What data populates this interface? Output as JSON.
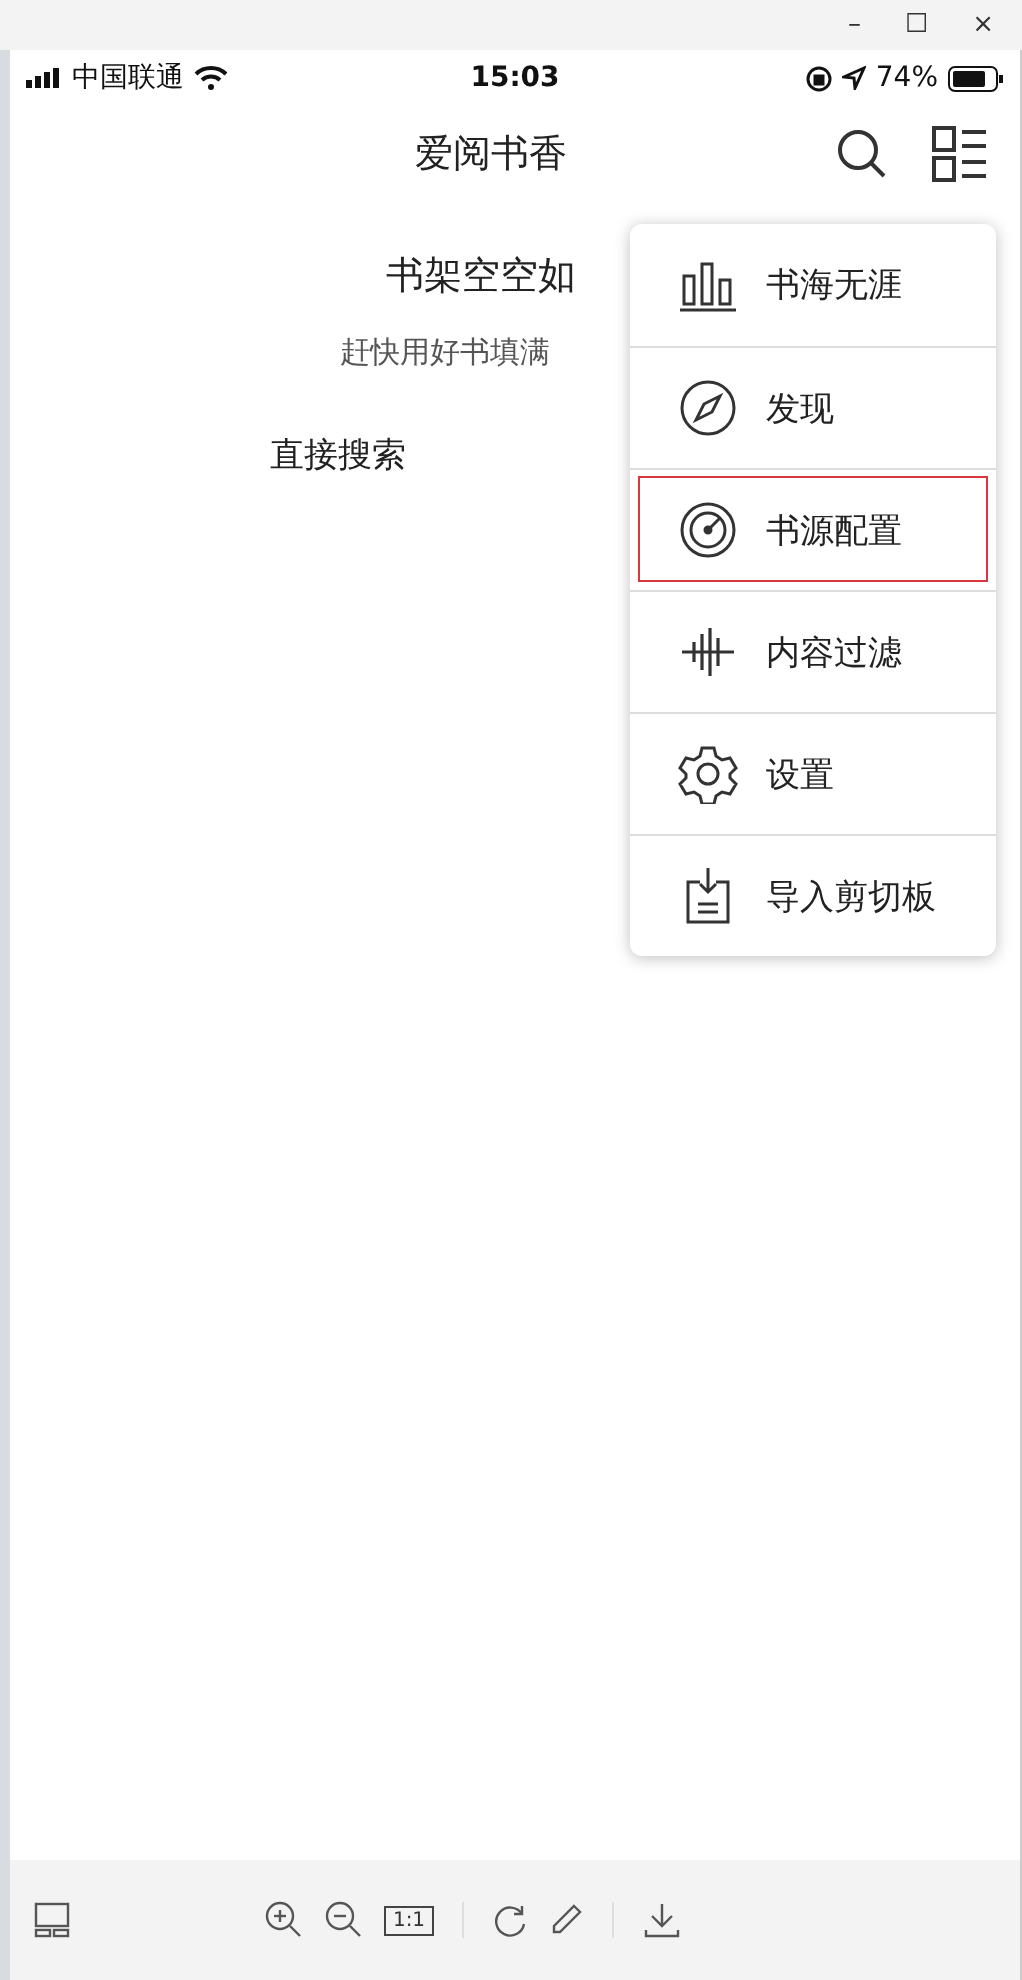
{
  "window": {
    "controls": [
      "–",
      "☐",
      "×"
    ]
  },
  "status_bar": {
    "carrier": "中国联通",
    "time": "15:03",
    "battery": "74%"
  },
  "nav": {
    "title": "爱阅书香"
  },
  "empty_state": {
    "title": "书架空空如",
    "subtitle": "赶快用好书填满",
    "actions": [
      "直接搜索"
    ]
  },
  "menu": [
    {
      "kind": "bars",
      "label": "书海无涯",
      "highlighted": false
    },
    {
      "kind": "compass",
      "label": "发现",
      "highlighted": false
    },
    {
      "kind": "gauge",
      "label": "书源配置",
      "highlighted": true
    },
    {
      "kind": "wave",
      "label": "内容过滤",
      "highlighted": false
    },
    {
      "kind": "gear",
      "label": "设置",
      "highlighted": false
    },
    {
      "kind": "clipboard",
      "label": "导入剪切板",
      "highlighted": false
    }
  ],
  "toolbar": {
    "actual_size": "1:1"
  }
}
